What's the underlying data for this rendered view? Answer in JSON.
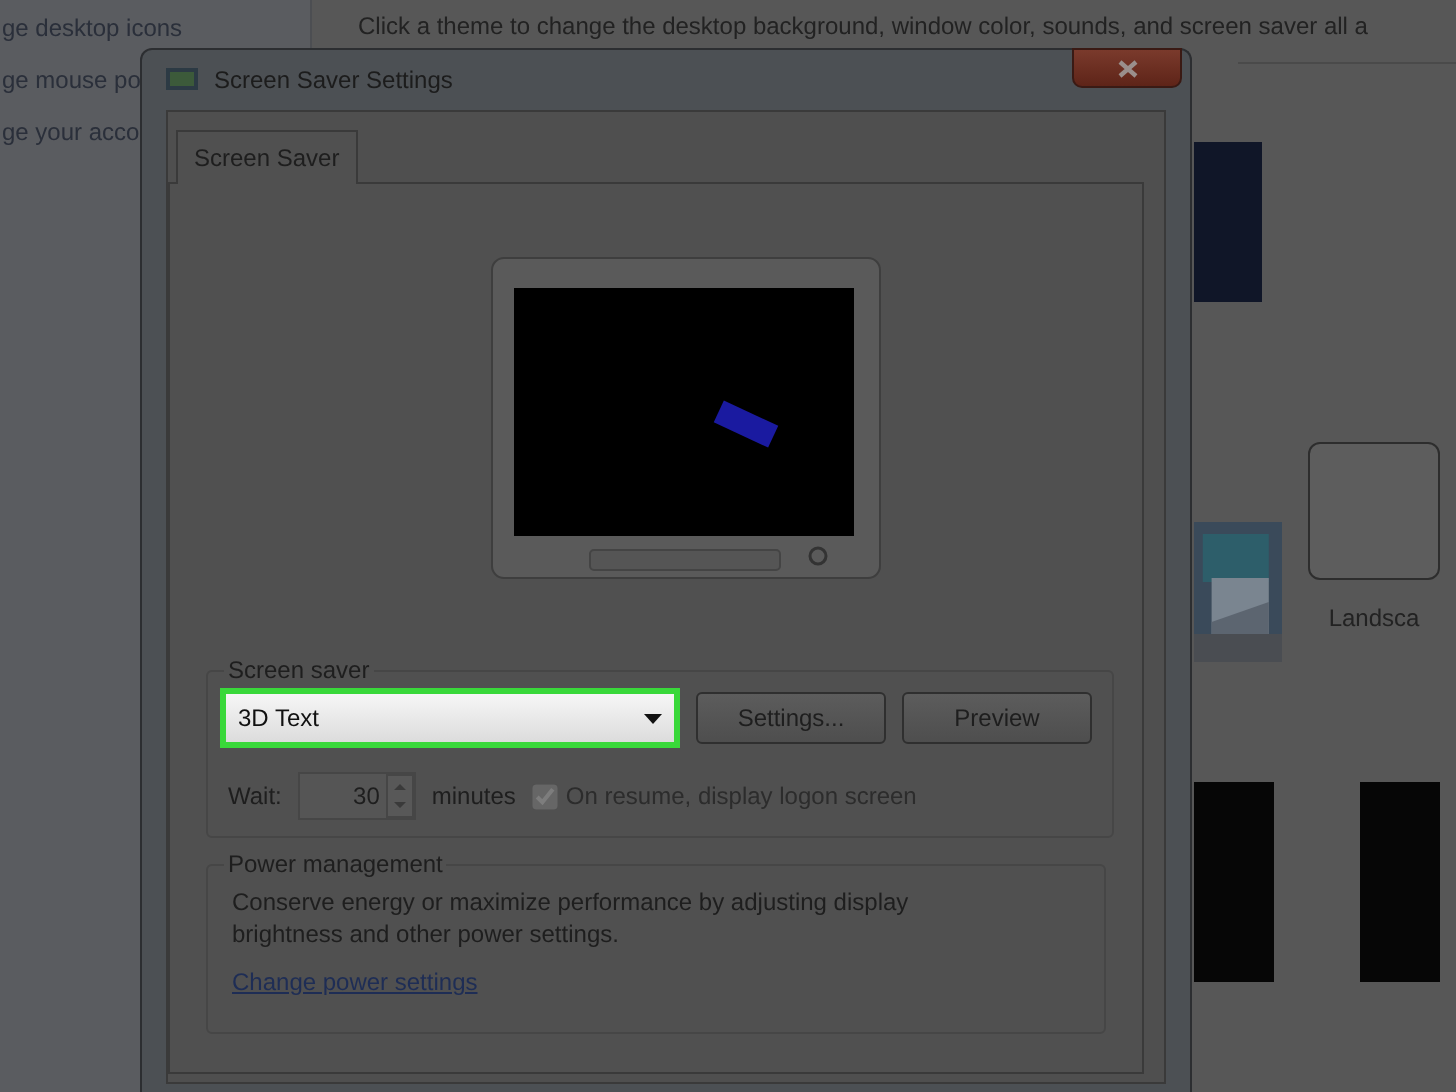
{
  "control_panel": {
    "sidebar_links": [
      "ge desktop icons",
      "ge mouse po",
      "ge your acco"
    ],
    "header": "Click a theme to change the desktop background, window color, sounds, and screen saver all a",
    "themes": [
      {
        "label": "Landsca"
      }
    ]
  },
  "dialog": {
    "title": "Screen Saver Settings",
    "tabs": [
      {
        "label": "Screen Saver",
        "selected": true
      }
    ],
    "screen_saver": {
      "legend": "Screen saver",
      "selected_saver": "3D Text",
      "highlighted": true,
      "buttons": [
        "Settings...",
        "Preview"
      ],
      "wait_label": "Wait:",
      "wait_value": "30",
      "wait_unit": "minutes",
      "logon": {
        "label": "On resume, display logon screen",
        "checked": true,
        "disabled": true
      }
    },
    "power": {
      "legend": "Power management",
      "description": "Conserve energy or maximize performance by adjusting display brightness and other power settings.",
      "link": "Change power settings"
    }
  }
}
